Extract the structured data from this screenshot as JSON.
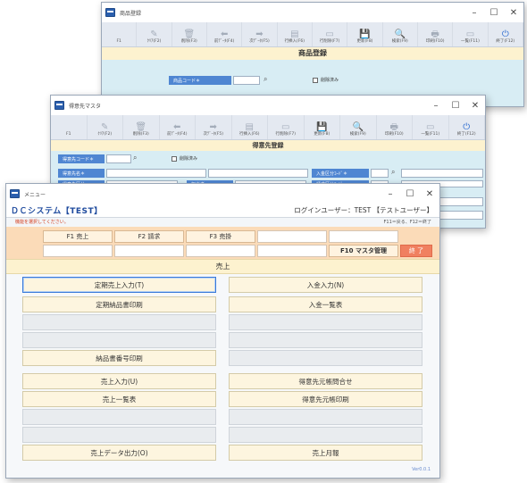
{
  "win1": {
    "title": "商品登録",
    "section_title": "商品登録",
    "field_code": "商品コード＊",
    "deleted_label": "削除済み",
    "toolbar": [
      {
        "label": "F1",
        "icon": "",
        "icon_name": "blank-icon"
      },
      {
        "label": "ｸﾘｱ(F2)",
        "icon": "✎",
        "icon_name": "clear-icon"
      },
      {
        "label": "削除(F3)",
        "icon": "🗑",
        "icon_name": "trash-icon"
      },
      {
        "label": "前ﾃﾞｰﾀ(F4)",
        "icon": "⬅",
        "icon_name": "arrow-left-icon"
      },
      {
        "label": "次ﾃﾞｰﾀ(F5)",
        "icon": "➡",
        "icon_name": "arrow-right-icon"
      },
      {
        "label": "行挿入(F6)",
        "icon": "▤",
        "icon_name": "row-insert-icon"
      },
      {
        "label": "行削除(F7)",
        "icon": "▭",
        "icon_name": "row-delete-icon"
      },
      {
        "label": "更新(F8)",
        "icon": "💾",
        "icon_name": "save-icon"
      },
      {
        "label": "検索(F9)",
        "icon": "🔍",
        "icon_name": "search-icon"
      },
      {
        "label": "印刷(F10)",
        "icon": "🖶",
        "icon_name": "print-icon"
      },
      {
        "label": "一覧(F11)",
        "icon": "▭",
        "icon_name": "list-icon"
      },
      {
        "label": "終了(F12)",
        "icon": "⏻",
        "icon_name": "exit-icon"
      }
    ]
  },
  "win2": {
    "title": "得意先マスタ",
    "section_title": "得意先登録",
    "field_code": "得意先コード＊",
    "field_name": "得意先名＊",
    "field_row2": "得意先区分",
    "field_row2b": "担当者",
    "field_right1": "入金区分ｺｰﾄﾞ＊",
    "field_right2": "請求区分ｺｰﾄﾞ",
    "deleted_label": "削除済み",
    "toolbar": [
      {
        "label": "F1",
        "icon": "",
        "icon_name": "blank-icon"
      },
      {
        "label": "ｸﾘｱ(F2)",
        "icon": "✎",
        "icon_name": "clear-icon"
      },
      {
        "label": "削除(F3)",
        "icon": "🗑",
        "icon_name": "trash-icon"
      },
      {
        "label": "前ﾃﾞｰﾀ(F4)",
        "icon": "⬅",
        "icon_name": "arrow-left-icon"
      },
      {
        "label": "次ﾃﾞｰﾀ(F5)",
        "icon": "➡",
        "icon_name": "arrow-right-icon"
      },
      {
        "label": "行挿入(F6)",
        "icon": "▤",
        "icon_name": "row-insert-icon"
      },
      {
        "label": "行削除(F7)",
        "icon": "▭",
        "icon_name": "row-delete-icon"
      },
      {
        "label": "更新(F8)",
        "icon": "💾",
        "icon_name": "save-icon"
      },
      {
        "label": "検索(F9)",
        "icon": "🔍",
        "icon_name": "search-icon"
      },
      {
        "label": "印刷(F10)",
        "icon": "🖶",
        "icon_name": "print-icon"
      },
      {
        "label": "一覧(F11)",
        "icon": "▭",
        "icon_name": "list-icon"
      },
      {
        "label": "終了(F12)",
        "icon": "⏻",
        "icon_name": "exit-icon"
      }
    ]
  },
  "menu": {
    "title": "メニュー",
    "system_name": "ＤＣシステム【TEST】",
    "login_info": "ログインユーザー：TEST 【テストユーザー】",
    "message": "機能を選択してください。",
    "hint": "F11＝戻る、F12＝終了",
    "fkeys_row1": [
      "F1 売上",
      "F2 請求",
      "F3 売掛",
      "",
      ""
    ],
    "fkeys_row2": [
      "",
      "",
      "",
      "",
      "F10 マスタ管理",
      "終 了"
    ],
    "section": "売上",
    "left_buttons": [
      "定期売上入力(T)",
      "定期納品書印刷",
      "",
      "",
      "納品書番号印刷",
      "売上入力(U)",
      "売上一覧表",
      "",
      "",
      "売上データ出力(O)"
    ],
    "right_buttons": [
      "入金入力(N)",
      "入金一覧表",
      "",
      "",
      "",
      "得意先元帳問合せ",
      "得意先元帳印刷",
      "",
      "",
      "売上月報"
    ],
    "version": "Ver0.0.1"
  },
  "colors": {
    "accent_blue": "#4f86d2",
    "section_yellow": "#fdf2cf",
    "fkey_peach": "#fbdbb8",
    "exit_red": "#f08060"
  }
}
